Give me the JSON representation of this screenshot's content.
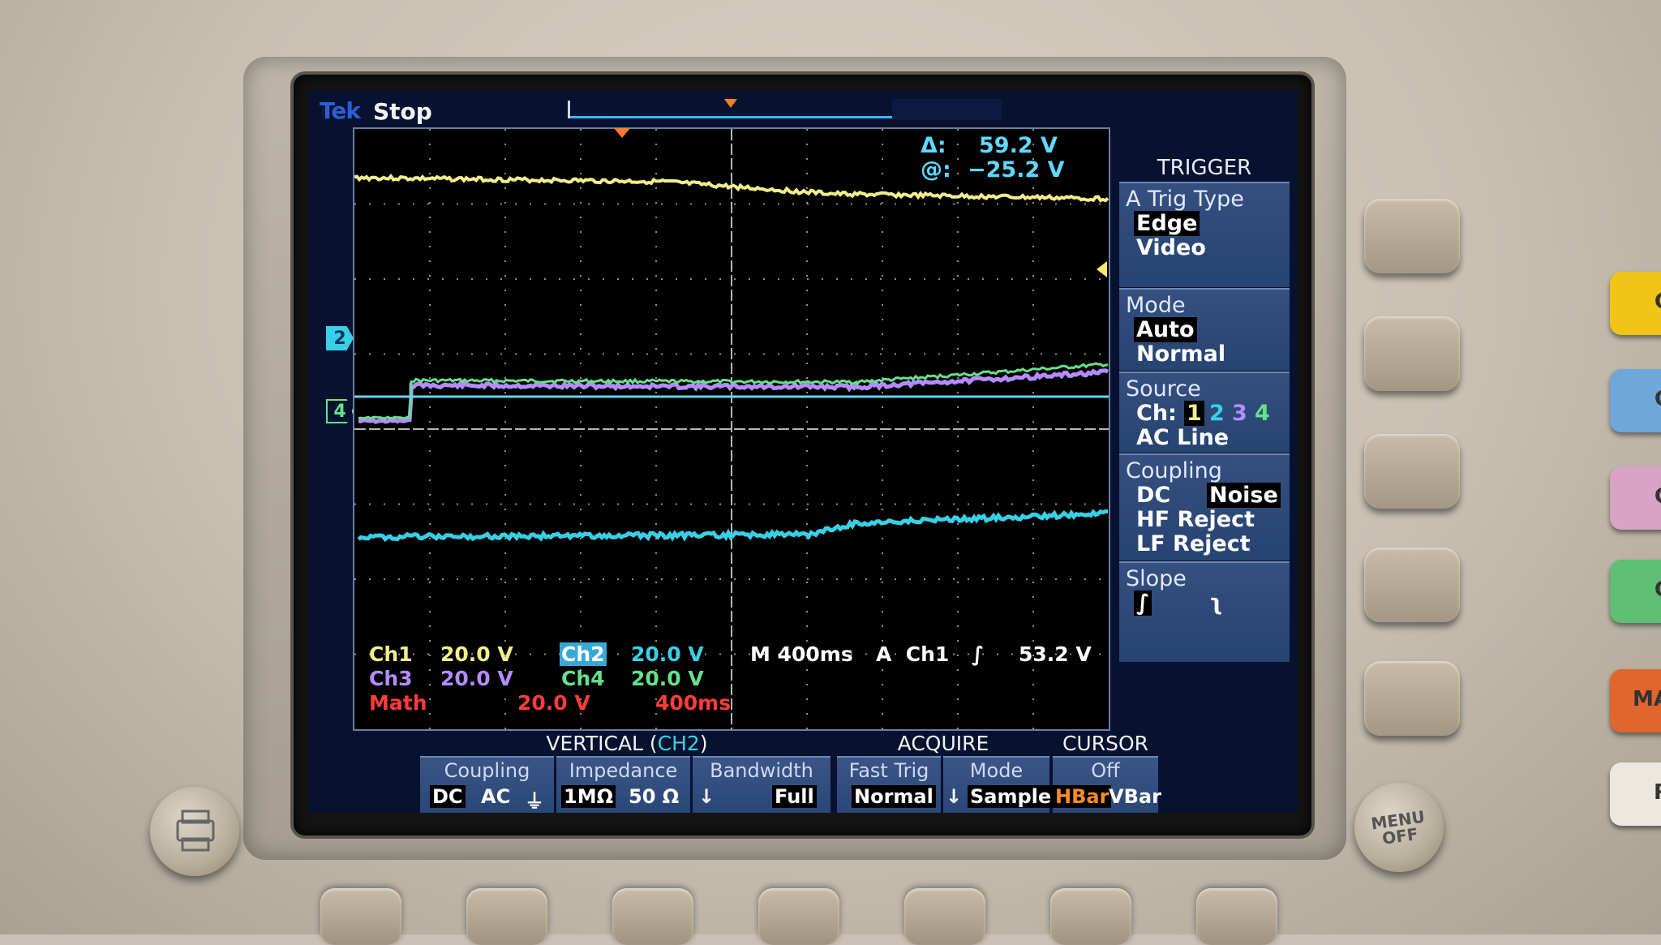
{
  "status": {
    "brand": "Tek",
    "run_state": "Stop"
  },
  "cursor_readout": {
    "delta_label": "Δ:",
    "delta_value": "59.2 V",
    "at_label": "@:",
    "at_value": "−25.2 V"
  },
  "markers": {
    "ch2": "2",
    "ch4": "4"
  },
  "channel_info": {
    "ch1_name": "Ch1",
    "ch1_scale": "20.0 V",
    "ch2_name": "Ch2",
    "ch2_scale": "20.0 V",
    "ch3_name": "Ch3",
    "ch3_scale": "20.0 V",
    "ch4_name": "Ch4",
    "ch4_scale": "20.0 V",
    "math_name": "Math",
    "math_scale": "20.0 V",
    "math_time": "400ms",
    "timebase": "M 400ms",
    "trigger_info": "A  Ch1",
    "trigger_slope_glyph": "∫",
    "trigger_level": "53.2 V"
  },
  "trigger_menu": {
    "title": "TRIGGER",
    "trig_type_header": "A Trig Type",
    "trig_type_options": [
      "Edge",
      "Video"
    ],
    "mode_header": "Mode",
    "mode_options": [
      "Auto",
      "Normal"
    ],
    "source_header": "Source",
    "source_ch_label": "Ch:",
    "source_channels": [
      "1",
      "2",
      "3",
      "4"
    ],
    "source_ac_line": "AC Line",
    "coupling_header": "Coupling",
    "coupling_options": [
      "DC",
      "Noise",
      "HF Reject",
      "LF Reject"
    ],
    "slope_header": "Slope",
    "slope_rise": "∫",
    "slope_fall": "ʅ"
  },
  "vertical_menu": {
    "title_prefix": "VERTICAL (",
    "title_channel": "CH2",
    "title_suffix": ")",
    "coupling_header": "Coupling",
    "coupling_dc": "DC",
    "coupling_ac": "AC",
    "coupling_gnd": "⏚",
    "impedance_header": "Impedance",
    "impedance_1m": "1MΩ",
    "impedance_50": "50 Ω",
    "bandwidth_header": "Bandwidth",
    "bandwidth_arrow": "↓",
    "bandwidth_value": "Full"
  },
  "acquire_menu": {
    "title": "ACQUIRE",
    "fast_trig_header": "Fast Trig",
    "fast_trig_value": "Normal",
    "mode_header": "Mode",
    "mode_arrow": "↓",
    "mode_value": "Sample"
  },
  "cursor_menu": {
    "title": "CURSOR",
    "state": "Off",
    "hbar": "HBar",
    "vbar": "VBar"
  },
  "hardware": {
    "menu_off_line1": "MENU",
    "menu_off_line2": "OFF",
    "color_buttons": [
      {
        "label": "C",
        "color": "#f0c419"
      },
      {
        "label": "C",
        "color": "#6fa7d8"
      },
      {
        "label": "C",
        "color": "#d9a3c6"
      },
      {
        "label": "C",
        "color": "#5fbf74"
      },
      {
        "label": "MA",
        "color": "#e0662e"
      },
      {
        "label": "R",
        "color": "#ece8e0"
      }
    ]
  },
  "colors": {
    "ch1": "#f2ee8c",
    "ch2": "#38d0e6",
    "ch3": "#b58cff",
    "ch4": "#66e08a",
    "math": "#ff3c3c",
    "menu_text": "#ffffff"
  }
}
